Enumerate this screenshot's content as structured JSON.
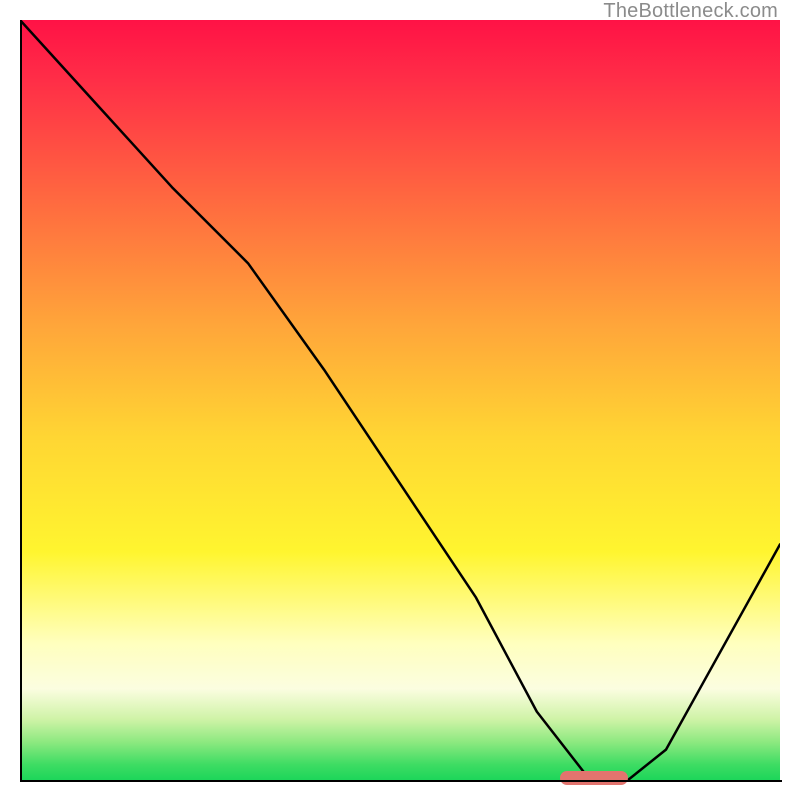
{
  "watermark": "TheBottleneck.com",
  "chart_data": {
    "type": "line",
    "title": "",
    "xlabel": "",
    "ylabel": "",
    "xlim": [
      0,
      100
    ],
    "ylim": [
      0,
      100
    ],
    "x": [
      0,
      10,
      20,
      30,
      40,
      50,
      60,
      68,
      75,
      80,
      85,
      90,
      95,
      100
    ],
    "y": [
      100,
      89,
      78,
      68,
      54,
      39,
      24,
      9,
      0,
      0,
      4,
      13,
      22,
      31
    ],
    "optimum_marker": {
      "x_start": 71,
      "x_end": 80,
      "y": 0
    },
    "background_gradient": {
      "top_color": "#ff1246",
      "mid_color": "#fff52f",
      "bottom_color": "#1dd65a"
    }
  }
}
